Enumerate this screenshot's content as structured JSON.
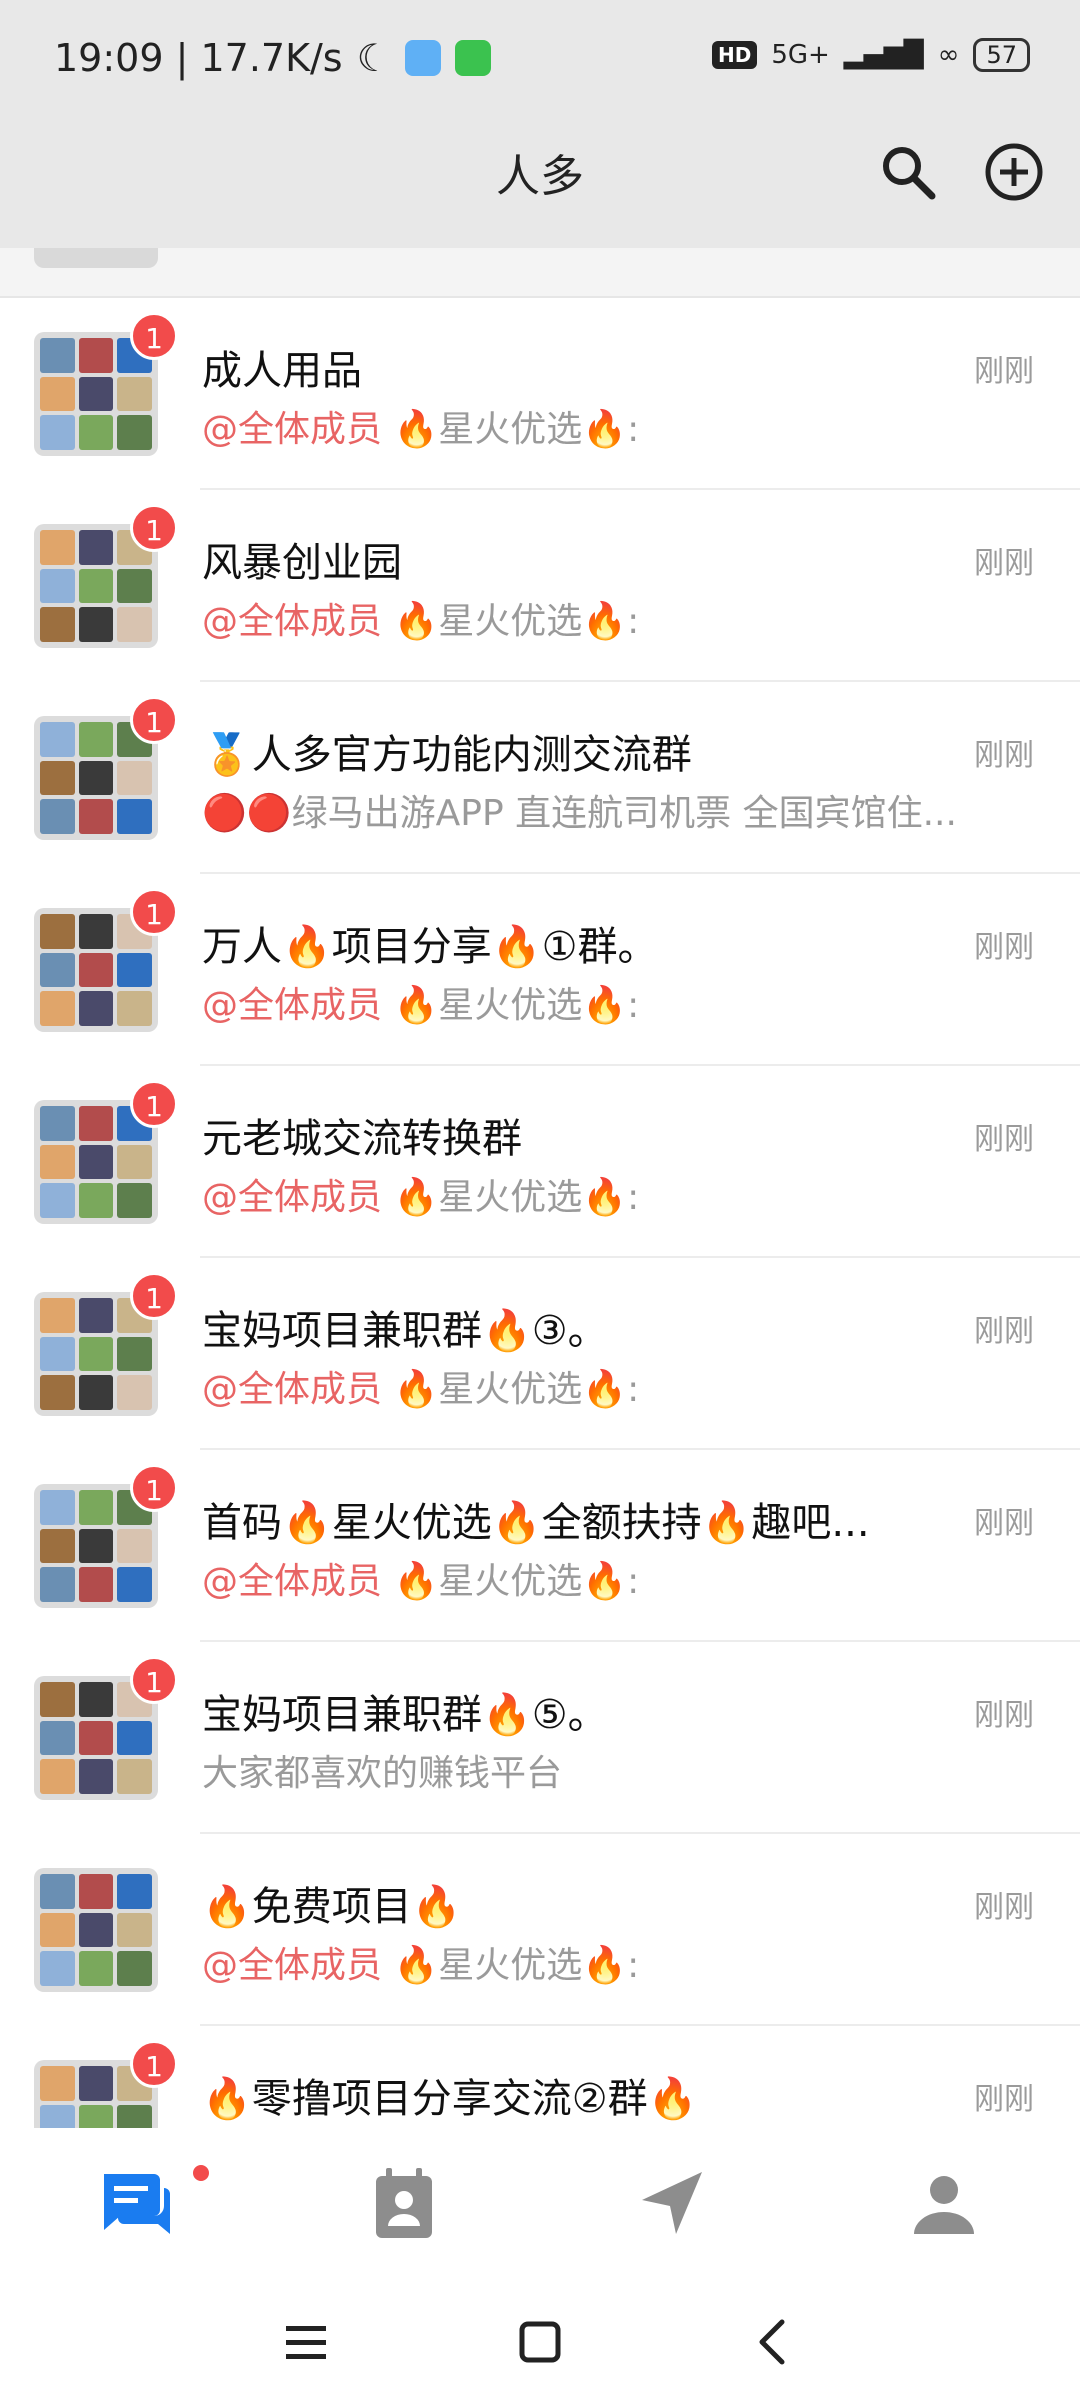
{
  "status_bar": {
    "time_speed": "19:09 | 17.7K/s",
    "battery": "57",
    "network": "5G+"
  },
  "header": {
    "title": "人多",
    "search_icon": "search-icon",
    "add_icon": "add-circle-icon"
  },
  "chats": [
    {
      "name": "成人用品",
      "time": "刚刚",
      "badge": "1",
      "mention": "@全体成员 ",
      "preview": "🔥星火优选🔥:"
    },
    {
      "name": "风暴创业园",
      "time": "刚刚",
      "badge": "1",
      "mention": "@全体成员 ",
      "preview": "🔥星火优选🔥:"
    },
    {
      "name": "🏅人多官方功能内测交流群",
      "time": "刚刚",
      "badge": "1",
      "mention": "",
      "preview": "🔴🔴绿马出游APP 直连航司机票 全国宾馆住..."
    },
    {
      "name": "万人🔥项目分享🔥①群。",
      "time": "刚刚",
      "badge": "1",
      "mention": "@全体成员 ",
      "preview": "🔥星火优选🔥:"
    },
    {
      "name": "元老城交流转换群",
      "time": "刚刚",
      "badge": "1",
      "mention": "@全体成员 ",
      "preview": "🔥星火优选🔥:"
    },
    {
      "name": "宝妈项目兼职群🔥③。",
      "time": "刚刚",
      "badge": "1",
      "mention": "@全体成员 ",
      "preview": "🔥星火优选🔥:"
    },
    {
      "name": "首码🔥星火优选🔥全额扶持🔥趣吧...",
      "time": "刚刚",
      "badge": "1",
      "mention": "@全体成员 ",
      "preview": "🔥星火优选🔥:"
    },
    {
      "name": "宝妈项目兼职群🔥⑤。",
      "time": "刚刚",
      "badge": "1",
      "mention": "",
      "preview": "大家都喜欢的赚钱平台"
    },
    {
      "name": "🔥免费项目🔥",
      "time": "刚刚",
      "badge": "",
      "mention": "@全体成员 ",
      "preview": "🔥星火优选🔥:"
    },
    {
      "name": "🔥零撸项目分享交流②群🔥",
      "time": "刚刚",
      "badge": "1",
      "mention": "",
      "preview": ""
    }
  ],
  "tabs": [
    {
      "icon": "chat-icon",
      "active": true
    },
    {
      "icon": "contacts-icon",
      "active": false
    },
    {
      "icon": "navigation-icon",
      "active": false
    },
    {
      "icon": "profile-icon",
      "active": false
    }
  ],
  "colors": {
    "accent": "#1a7cf0",
    "badge": "#f24b4b",
    "mention": "#e86464"
  }
}
